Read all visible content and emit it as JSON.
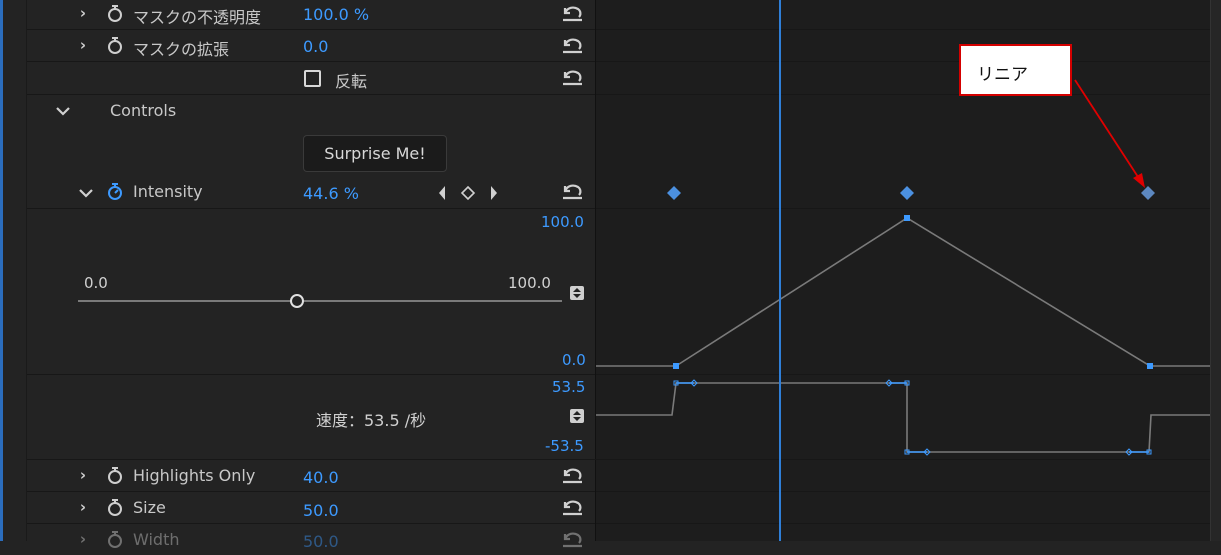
{
  "rows": {
    "mask_opacity": {
      "label": "マスクの不透明度",
      "value": "100.0 %"
    },
    "mask_expansion": {
      "label": "マスクの拡張",
      "value": "0.0"
    },
    "invert": {
      "label": "反転"
    },
    "controls": {
      "label": "Controls"
    },
    "surprise": {
      "label": "Surprise Me!"
    },
    "intensity": {
      "label": "Intensity",
      "value": "44.6 %"
    },
    "highlights_only": {
      "label": "Highlights Only",
      "value": "40.0"
    },
    "size": {
      "label": "Size",
      "value": "50.0"
    },
    "width": {
      "label": "Width",
      "value": "50.0"
    }
  },
  "intensity_graph": {
    "max_label": "100.0",
    "min_label": "0.0",
    "slider_min": "0.0",
    "slider_max": "100.0",
    "slider_value_fraction": 0.446
  },
  "velocity_graph": {
    "max_label": "53.5",
    "min_label": "-53.5",
    "speed_text": "速度：53.5 /秒"
  },
  "annotation": {
    "text": "リニア"
  },
  "colors": {
    "accent": "#3d9aff",
    "keyframe": "#4b90e0",
    "callout_border": "#d40000",
    "arrow": "#e00000"
  }
}
